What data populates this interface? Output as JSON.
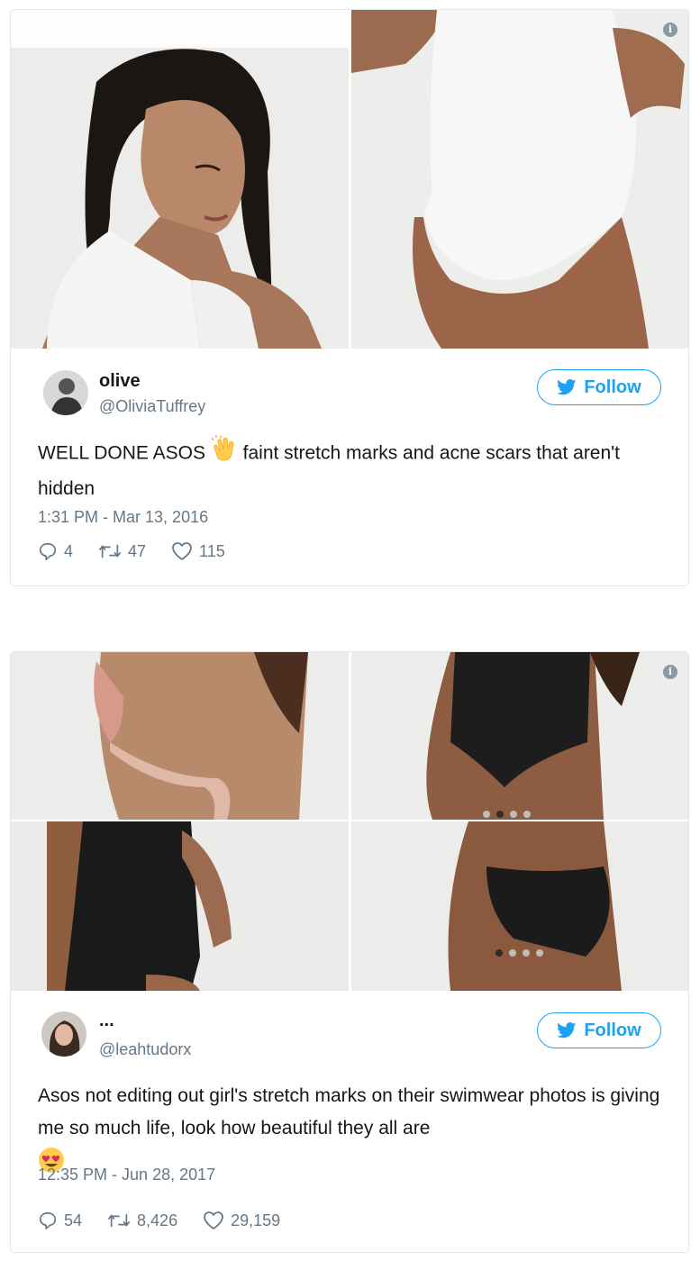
{
  "colors": {
    "twitter_blue": "#1da1f2",
    "secondary": "#657786",
    "border": "#e1e8ed"
  },
  "tweets": [
    {
      "name": "olive",
      "handle": "@OliviaTuffrey",
      "follow_label": "Follow",
      "text_part1": "WELL DONE ASOS",
      "emoji1": "clapping-hands-emoji",
      "text_part2": "faint stretch marks and acne scars that aren't hidden",
      "timestamp": "1:31 PM - Mar 13, 2016",
      "replies": "4",
      "retweets": "47",
      "likes": "115"
    },
    {
      "name": "...",
      "handle": "@leahtudorx",
      "follow_label": "Follow",
      "text": "Asos not editing out girl's stretch marks on their swimwear photos is giving me so much life, look how beautiful they all are",
      "emoji": "heart-eyes-emoji",
      "timestamp": "12:35 PM - Jun 28, 2017",
      "replies": "54",
      "retweets": "8,426",
      "likes": "29,159"
    }
  ]
}
